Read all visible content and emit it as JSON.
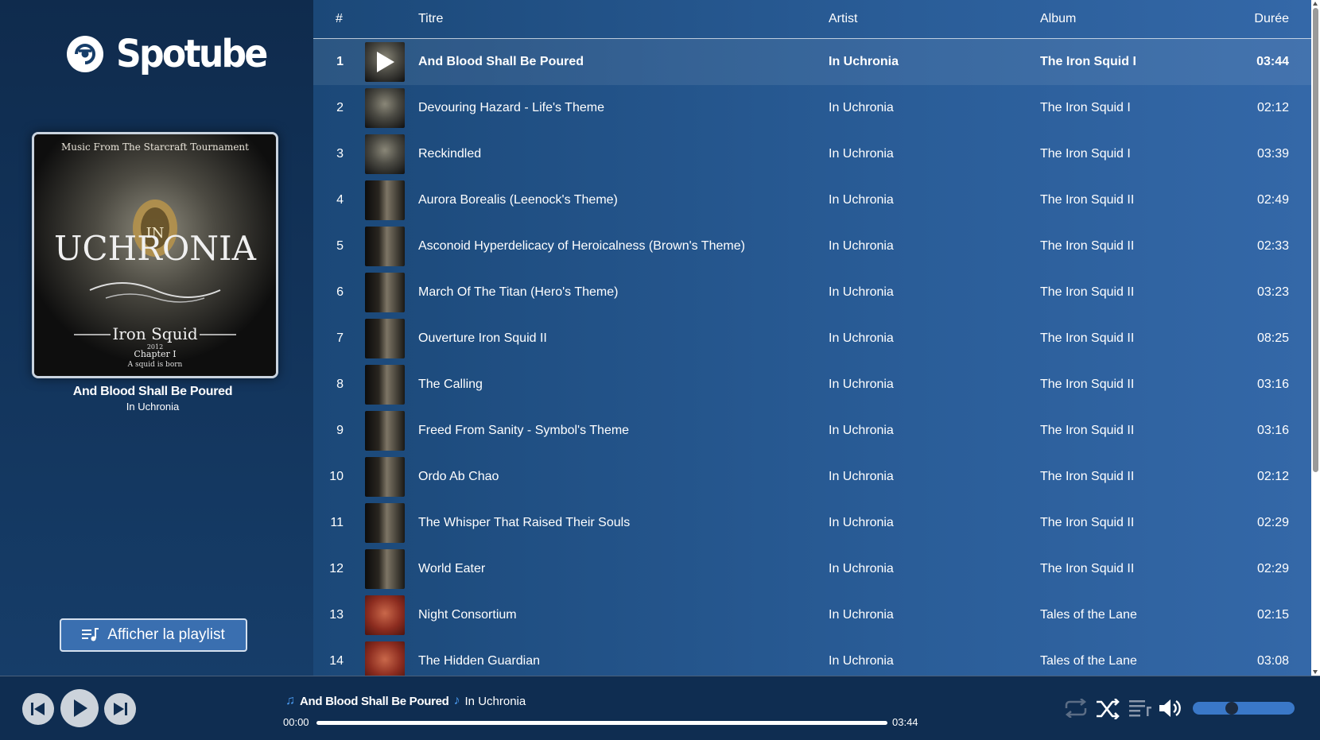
{
  "app": {
    "name": "Spotube"
  },
  "now_playing": {
    "title": "And Blood Shall Be Poured",
    "artist": "In Uchronia"
  },
  "cover": {
    "top_text": "Music From The Starcraft Tournament",
    "main_text": "UCHRONIA",
    "in_text": "IN",
    "iron_squid": "Iron Squid",
    "chapter": "Chapter I",
    "tagline": "A squid is born",
    "year": "2012"
  },
  "sidebar": {
    "playlist_button": "Afficher la playlist"
  },
  "columns": {
    "num": "#",
    "title": "Titre",
    "artist": "Artist",
    "album": "Album",
    "duration": "Durée"
  },
  "tracks": [
    {
      "num": "1",
      "title": "And Blood Shall Be Poured",
      "artist": "In Uchronia",
      "album": "The Iron Squid I",
      "duration": "03:44"
    },
    {
      "num": "2",
      "title": "Devouring Hazard - Life's Theme",
      "artist": "In Uchronia",
      "album": "The Iron Squid I",
      "duration": "02:12"
    },
    {
      "num": "3",
      "title": "Reckindled",
      "artist": "In Uchronia",
      "album": "The Iron Squid I",
      "duration": "03:39"
    },
    {
      "num": "4",
      "title": "Aurora Borealis (Leenock's Theme)",
      "artist": "In Uchronia",
      "album": "The Iron Squid II",
      "duration": "02:49"
    },
    {
      "num": "5",
      "title": "Asconoid Hyperdelicacy of Heroicalness (Brown's Theme)",
      "artist": "In Uchronia",
      "album": "The Iron Squid II",
      "duration": "02:33"
    },
    {
      "num": "6",
      "title": "March Of The Titan (Hero's Theme)",
      "artist": "In Uchronia",
      "album": "The Iron Squid II",
      "duration": "03:23"
    },
    {
      "num": "7",
      "title": "Ouverture Iron Squid II",
      "artist": "In Uchronia",
      "album": "The Iron Squid II",
      "duration": "08:25"
    },
    {
      "num": "8",
      "title": "The Calling",
      "artist": "In Uchronia",
      "album": "The Iron Squid II",
      "duration": "03:16"
    },
    {
      "num": "9",
      "title": "Freed From Sanity - Symbol's Theme",
      "artist": "In Uchronia",
      "album": "The Iron Squid II",
      "duration": "03:16"
    },
    {
      "num": "10",
      "title": "Ordo Ab Chao",
      "artist": "In Uchronia",
      "album": "The Iron Squid II",
      "duration": "02:12"
    },
    {
      "num": "11",
      "title": "The Whisper That Raised Their Souls",
      "artist": "In Uchronia",
      "album": "The Iron Squid II",
      "duration": "02:29"
    },
    {
      "num": "12",
      "title": "World Eater",
      "artist": "In Uchronia",
      "album": "The Iron Squid II",
      "duration": "02:29"
    },
    {
      "num": "13",
      "title": "Night Consortium",
      "artist": "In Uchronia",
      "album": "Tales of the Lane",
      "duration": "02:15"
    },
    {
      "num": "14",
      "title": "The Hidden Guardian",
      "artist": "In Uchronia",
      "album": "Tales of the Lane",
      "duration": "03:08"
    }
  ],
  "player": {
    "title": "And Blood Shall Be Poured",
    "artist": "In Uchronia",
    "elapsed": "00:00",
    "total": "03:44",
    "progress_fraction": 0.0,
    "volume_fraction": 0.37
  },
  "icons": {
    "logo": "spotube-logo-icon",
    "playlist": "queue-music-icon",
    "prev": "skip-previous-icon",
    "play": "play-icon",
    "next": "skip-next-icon",
    "repeat": "repeat-icon",
    "shuffle": "shuffle-icon",
    "queue": "queue-icon",
    "volume": "volume-icon",
    "note": "music-note-icon"
  },
  "colors": {
    "accent": "#3a78c8",
    "note": "#4b9bf0",
    "bar_bg": "#0f2d51"
  }
}
